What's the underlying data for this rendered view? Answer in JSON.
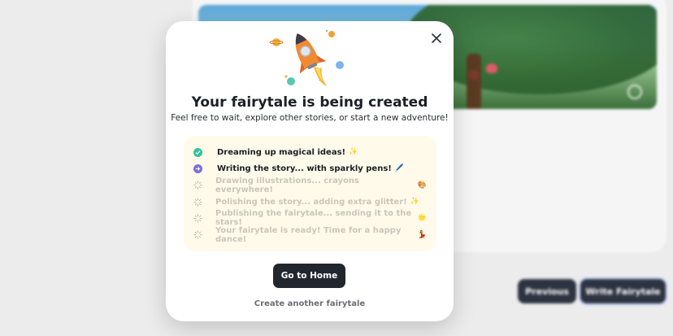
{
  "background": {
    "buttons": {
      "previous": "Previous",
      "write": "Write Fairytale"
    }
  },
  "modal": {
    "illustration": "rocket-with-planets-icon",
    "title": "Your fairytale is being created",
    "subtitle": "Feel free to wait, explore other stories, or start a new adventure!",
    "steps": [
      {
        "label": "Dreaming up magical ideas!",
        "emoji": "✨",
        "status": "done"
      },
      {
        "label": "Writing the story... with sparkly pens!",
        "emoji": "🖊️",
        "status": "active"
      },
      {
        "label": "Drawing illustrations... crayons everywhere!",
        "emoji": "🎨",
        "status": "pending"
      },
      {
        "label": "Polishing the story... adding extra glitter!",
        "emoji": "✨",
        "status": "pending"
      },
      {
        "label": "Publishing the fairytale... sending it to the stars!",
        "emoji": "🌟",
        "status": "pending"
      },
      {
        "label": "Your fairytale is ready! Time for a happy dance!",
        "emoji": "💃",
        "status": "pending"
      }
    ],
    "primary_button": "Go to Home",
    "secondary_link": "Create another fairytale"
  },
  "colors": {
    "done": "#2fc39b",
    "active": "#7b6fe0",
    "pending_text": "#c9c6bb",
    "steps_bg": "#fffaea",
    "primary_button": "#22262f"
  }
}
